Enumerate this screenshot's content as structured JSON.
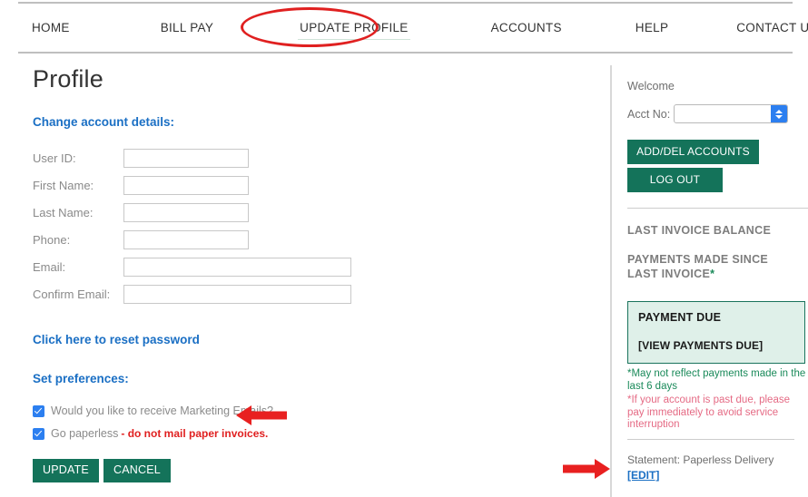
{
  "nav": {
    "items": [
      {
        "id": "home",
        "label": "HOME",
        "active": false
      },
      {
        "id": "billpay",
        "label": "BILL PAY",
        "active": false
      },
      {
        "id": "update",
        "label": "UPDATE PROFILE",
        "active": true
      },
      {
        "id": "accounts",
        "label": "ACCOUNTS",
        "active": false
      },
      {
        "id": "help",
        "label": "HELP",
        "active": false
      },
      {
        "id": "contact",
        "label": "CONTACT US",
        "active": false
      }
    ]
  },
  "main": {
    "page_title": "Profile",
    "change_details_heading": "Change account details:",
    "fields": [
      {
        "id": "user-id",
        "label": "User ID:",
        "value": "",
        "placeholder": "",
        "width": "short"
      },
      {
        "id": "first-name",
        "label": "First Name:",
        "value": "",
        "placeholder": "",
        "width": "short"
      },
      {
        "id": "last-name",
        "label": "Last Name:",
        "value": "",
        "placeholder": "",
        "width": "short"
      },
      {
        "id": "phone",
        "label": "Phone:",
        "value": "",
        "placeholder": "",
        "width": "short"
      },
      {
        "id": "email",
        "label": "Email:",
        "value": "",
        "placeholder": "",
        "width": "long"
      },
      {
        "id": "confirm-email",
        "label": "Confirm Email:",
        "value": "",
        "placeholder": "",
        "width": "long"
      }
    ],
    "reset_password_link": "Click here to reset password",
    "preferences_heading": "Set preferences:",
    "checkboxes": [
      {
        "id": "marketing-emails",
        "label": "Would you like to receive Marketing Emails?",
        "emphasis": "",
        "checked": true
      },
      {
        "id": "go-paperless",
        "label": "Go paperless",
        "emphasis": "- do not mail paper invoices.",
        "checked": true
      }
    ],
    "update_button": "UPDATE",
    "cancel_button": "CANCEL"
  },
  "sidebar": {
    "welcome": "Welcome",
    "acct_label": "Acct No:",
    "acct_value": "",
    "add_del_accounts_button": "ADD/DEL ACCOUNTS",
    "log_out_button": "LOG OUT",
    "last_invoice_balance": "LAST INVOICE BALANCE",
    "payments_made_since": "PAYMENTS MADE SINCE",
    "last_invoice_line2": "LAST INVOICE",
    "last_invoice_asterisk": "*",
    "payment_due_title": "PAYMENT DUE",
    "view_payments_due": "[VIEW PAYMENTS DUE]",
    "note_1": "*May not reflect payments made in the last 6 days",
    "note_2": "*If your account is past due, please pay immediately to avoid service interruption",
    "statement_text": "Statement: Paperless Delivery",
    "statement_edit": "[EDIT]"
  },
  "annotations": {
    "ellipse_target": "UPDATE PROFILE",
    "arrow_paperless_direction": "left",
    "arrow_statement_direction": "right",
    "annotation_color": "#e02020"
  },
  "colors": {
    "link_blue": "#1a6fc4",
    "button_green": "#14735a",
    "checkbox_blue": "#2c7ff0",
    "payment_box_bg": "#dff0e9",
    "payment_box_border": "#19735c",
    "note_green": "#1a8a5a",
    "note_pink": "#e56a84",
    "annotation_red": "#e02020"
  }
}
